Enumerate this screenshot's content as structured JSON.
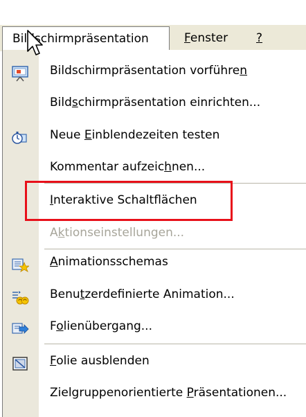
{
  "menubar": {
    "active_menu": {
      "label": "Bildschirmpräsentation"
    },
    "fenster": {
      "label": "Fenster",
      "mnemonic": "F",
      "rest": "enster"
    },
    "help": {
      "label": "?"
    }
  },
  "dropdown": {
    "items": [
      {
        "label": "Bildschirmpräsentation vorführen",
        "before": "Bildschirmpräsentation vorführe",
        "mnemonic": "n",
        "after": "",
        "icon": "slideshow-screen-icon",
        "enabled": true
      },
      {
        "label": "Bildschirmpräsentation einrichten...",
        "before": "Bild",
        "mnemonic": "s",
        "after": "chirmpräsentation einrichten...",
        "icon": "",
        "enabled": true
      },
      {
        "label": "Neue Einblendezeiten testen",
        "before": "Neue ",
        "mnemonic": "E",
        "after": "inblendezeiten testen",
        "icon": "stopwatch-icon",
        "enabled": true
      },
      {
        "label": "Kommentar aufzeichnen...",
        "before": "Kommentar aufzeic",
        "mnemonic": "h",
        "after": "nen...",
        "icon": "",
        "enabled": true
      },
      {
        "label": "Interaktive Schaltflächen",
        "before": "",
        "mnemonic": "I",
        "after": "nteraktive Schaltflächen",
        "icon": "",
        "enabled": true
      },
      {
        "label": "Aktionseinstellungen...",
        "before": "A",
        "mnemonic": "k",
        "after": "tionseinstellungen...",
        "icon": "",
        "enabled": false
      },
      {
        "label": "Animationsschemas",
        "before": "",
        "mnemonic": "A",
        "after": "nimationsschemas",
        "icon": "animation-schemes-icon",
        "enabled": true
      },
      {
        "label": "Benutzerdefinierte Animation...",
        "before": "Benu",
        "mnemonic": "t",
        "after": "zerdefinierte Animation...",
        "icon": "custom-animation-icon",
        "enabled": true
      },
      {
        "label": "Folienübergang...",
        "before": "F",
        "mnemonic": "o",
        "after": "lienübergang...",
        "icon": "slide-transition-icon",
        "enabled": true
      },
      {
        "label": "Folie ausblenden",
        "before": "",
        "mnemonic": "F",
        "after": "olie ausblenden",
        "icon": "hide-slide-icon",
        "enabled": true
      },
      {
        "label": "Zielgruppenorientierte Präsentationen...",
        "before": "Zielgruppenorientierte ",
        "mnemonic": "P",
        "after": "räsentationen...",
        "icon": "",
        "enabled": true
      }
    ]
  },
  "colors": {
    "menubar_bg": "#ece9d8",
    "icon_strip_bg": "#ebe8dc",
    "highlight_border": "#e8101a",
    "disabled_text": "#a7a59a"
  }
}
